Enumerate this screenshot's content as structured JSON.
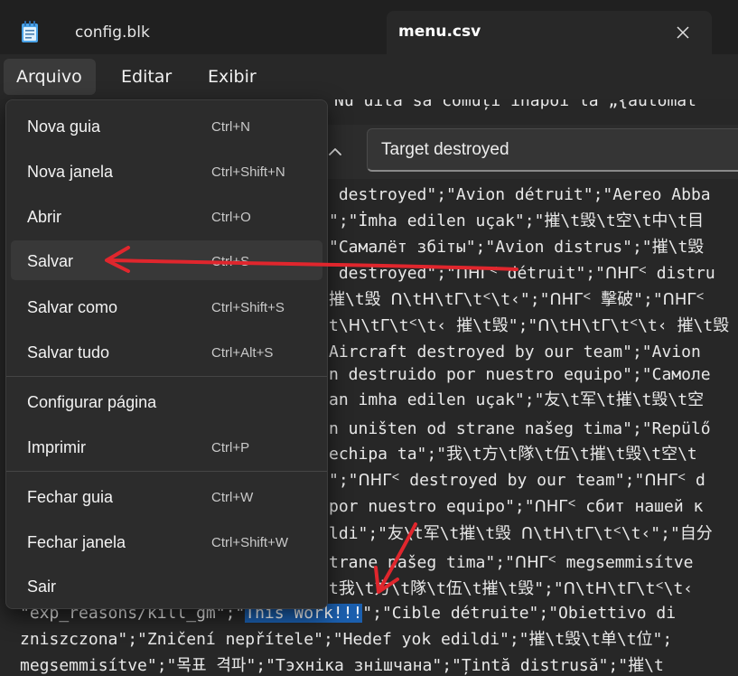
{
  "tabs": [
    {
      "label": "config.blk",
      "active": false
    },
    {
      "label": "menu.csv",
      "active": true
    }
  ],
  "icons": {
    "app": "notepad-icon",
    "close": "close-icon",
    "find_up": "chevron-up-icon"
  },
  "menubar": {
    "file": "Arquivo",
    "edit": "Editar",
    "view": "Exibir"
  },
  "find": {
    "query": "Target destroyed"
  },
  "dropdown": {
    "items": [
      {
        "label": "Nova guia",
        "shortcut": "Ctrl+N"
      },
      {
        "label": "Nova janela",
        "shortcut": "Ctrl+Shift+N"
      },
      {
        "label": "Abrir",
        "shortcut": "Ctrl+O"
      },
      {
        "label": "Salvar",
        "shortcut": "Ctrl+S"
      },
      {
        "label": "Salvar como",
        "shortcut": "Ctrl+Shift+S"
      },
      {
        "label": "Salvar tudo",
        "shortcut": "Ctrl+Alt+S"
      },
      {
        "label": "Configurar página",
        "shortcut": ""
      },
      {
        "label": "Imprimir",
        "shortcut": "Ctrl+P"
      },
      {
        "label": "Fechar guia",
        "shortcut": "Ctrl+W"
      },
      {
        "label": "Fechar janela",
        "shortcut": "Ctrl+Shift+W"
      },
      {
        "label": "Sair",
        "shortcut": ""
      }
    ]
  },
  "editor": {
    "lines": [
      "Nu uita să comuți înapoi la „{automat",
      " destroyed\";\"Avion détruit\";\"Aereo Abba",
      "\";\"İmha edilen uçak\";\"摧\\t毁\\t空\\t中\\t目",
      "\"Самалёт збіты\";\"Avion distrus\";\"摧\\t毁",
      " destroyed\";\"ᑎᕼᒥᑉ détruit\";\"ᑎᕼᒥᑉ distru",
      "摧\\t毁 ᑎ\\tᕼ\\tᒥ\\tᑉ\\t‹\";\"ᑎᕼᒥᑉ 擊破\";\"ᑎᕼᒥᑉ",
      "t\\ᕼ\\tᒥ\\tᑉ\\t‹ 摧\\t毁\";\"ᑎ\\tᕼ\\tᒥ\\tᑉ\\t‹ 摧\\t毁",
      "Aircraft destroyed by our team\";\"Avion",
      "n destruido por nuestro equipo\";\"Самоле",
      "an imha edilen uçak\";\"友\\t军\\t摧\\t毁\\t空",
      "n uništen od strane našeg tima\";\"Repülő",
      "echipa ta\";\"我\\t方\\t隊\\t伍\\t摧\\t毁\\t空\\t",
      "\";\"ᑎᕼᒥᑉ destroyed by our team\";\"ᑎᕼᒥᑉ d",
      "por nuestro equipo\";\"ᑎᕼᒥᑉ сбит нашей к",
      "ldi\";\"友\\t军\\t摧\\t毁 ᑎ\\tᕼ\\tᒥ\\tᑉ\\t‹\";\"自分",
      "trane našeg tima\";\"ᑎᕼᒥᑉ megsemmisítve",
      "t我\\t方\\t隊\\t伍\\t摧\\t毁\";\"ᑎ\\tᕼ\\tᒥ\\tᑉ\\t‹ "
    ],
    "line_exp": {
      "prefix": "\"exp_reasons/kill_gm\";\"",
      "selected": "This Work!!!",
      "suffix": "\";\"Cible détruite\";\"Obiettivo di"
    },
    "line_zn": "zniszczona\";\"Zničení nepřítele\";\"Hedef yok edildi\";\"摧\\t毁\\t单\\t位\";",
    "line_megs": "megsemmisítve\";\"목표 격파\";\"Тэхніка знішчана\";\"Țintă distrusă\";\"摧\\t"
  },
  "annotation_color": "#e0262d"
}
